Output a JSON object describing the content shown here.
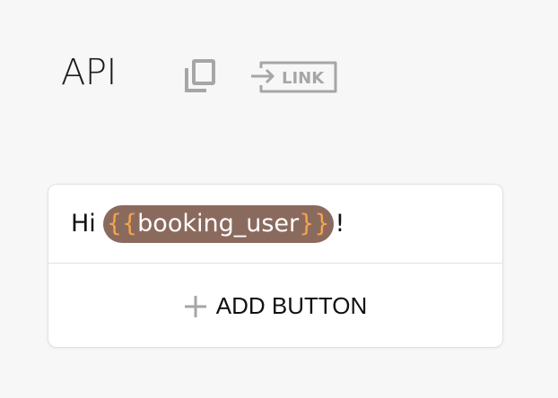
{
  "header": {
    "title": "API",
    "copy_icon": "copy-icon",
    "link_icon": "link-arrow-icon",
    "link_label": "LINK"
  },
  "message": {
    "prefix": "Hi",
    "variable_open": "{{",
    "variable_name": "booking_user",
    "variable_close": "}}",
    "suffix": "!"
  },
  "actions": {
    "add_button_label": "ADD BUTTON",
    "add_icon": "plus-icon"
  },
  "colors": {
    "variable_bg": "#8b6a5e",
    "brace": "#f3a44e",
    "icon_gray": "#a6a6a6"
  }
}
